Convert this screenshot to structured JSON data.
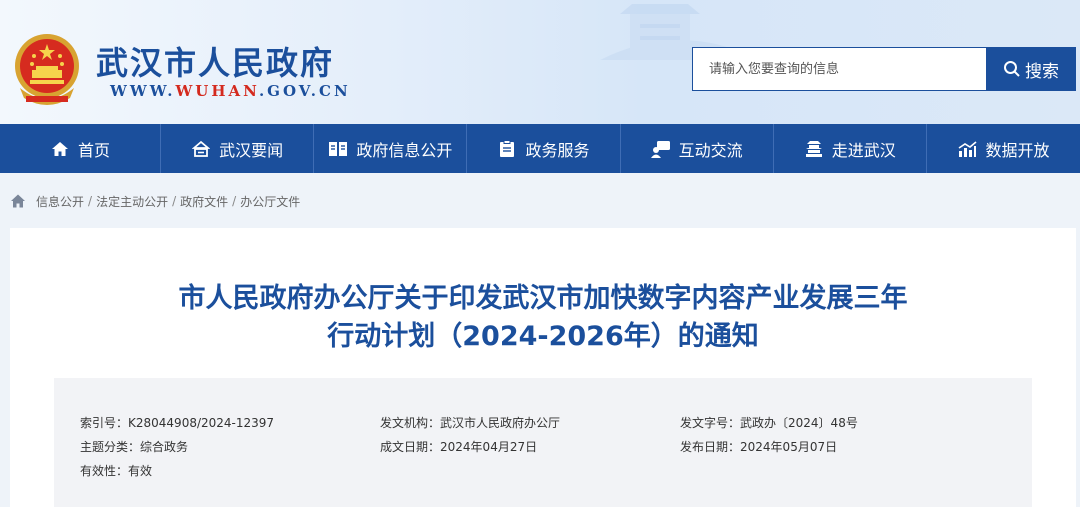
{
  "header": {
    "site_title": "武汉市人民政府",
    "url_prefix": "WWW.",
    "url_brand": "WUHAN",
    "url_suffix": ".GOV.CN",
    "search_placeholder": "请输入您要查询的信息",
    "search_button": "搜索",
    "brand_color": "#1b4f9c",
    "accent_color": "#d42a1e"
  },
  "nav": {
    "items": [
      {
        "label": "首页",
        "icon": "home-icon"
      },
      {
        "label": "武汉要闻",
        "icon": "news-icon"
      },
      {
        "label": "政府信息公开",
        "icon": "book-icon"
      },
      {
        "label": "政务服务",
        "icon": "clipboard-icon"
      },
      {
        "label": "互动交流",
        "icon": "chat-icon"
      },
      {
        "label": "走进武汉",
        "icon": "building-icon"
      },
      {
        "label": "数据开放",
        "icon": "chart-icon"
      }
    ]
  },
  "breadcrumb": {
    "items": [
      "信息公开",
      "法定主动公开",
      "政府文件",
      "办公厅文件"
    ],
    "separator": "/"
  },
  "document": {
    "title_line1": "市人民政府办公厅关于印发武汉市加快数字内容产业发展三年",
    "title_line2": "行动计划（2024-2026年）的通知",
    "meta": {
      "index_label": "索引号：",
      "index_value": "K28044908/2024-12397",
      "issuer_label": "发文机构：",
      "issuer_value": "武汉市人民政府办公厅",
      "docno_label": "发文字号：",
      "docno_value": "武政办〔2024〕48号",
      "topic_label": "主题分类：",
      "topic_value": "综合政务",
      "created_label": "成文日期：",
      "created_value": "2024年04月27日",
      "published_label": "发布日期：",
      "published_value": "2024年05月07日",
      "validity_label": "有效性：",
      "validity_value": "有效"
    }
  }
}
